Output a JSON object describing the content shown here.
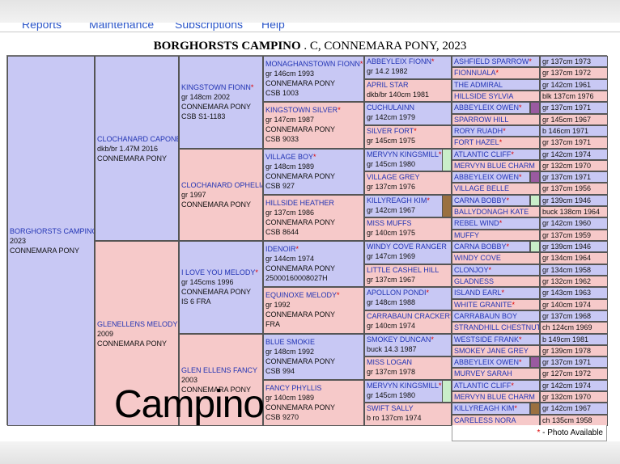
{
  "nav": [
    "Reports",
    "Maintenance",
    "Subscriptions",
    "Help"
  ],
  "title": {
    "bold": "BORGHORSTS CAMPINO",
    "rest": " . C, CONNEMARA PONY, 2023"
  },
  "watermark": "Campino",
  "footer": {
    "star": "*",
    "text": " - Photo Available"
  },
  "colors": {
    "male": "#c8c8f4",
    "female": "#f6c9c9",
    "link": "#2234b4",
    "star": "#dd0000",
    "swatch_green": "#c9eec9",
    "swatch_brown": "#9a7040",
    "swatch_purple": "#9a5aa0"
  },
  "horses": [
    {
      "id": "g1",
      "sex": "m",
      "name": "BORGHORSTS CAMPINO",
      "star": false,
      "lines": [
        "2023",
        "CONNEMARA PONY"
      ]
    },
    {
      "id": "g2s",
      "sex": "m",
      "name": "CLOCHANARD CAPONE",
      "star": false,
      "lines": [
        "dkb/br 1.47M 2016",
        "CONNEMARA PONY"
      ]
    },
    {
      "id": "g2d",
      "sex": "f",
      "name": "GLENELLENS MELODY",
      "star": false,
      "lines": [
        "2009",
        "CONNEMARA PONY"
      ]
    },
    {
      "id": "g3a",
      "sex": "m",
      "name": "KINGSTOWN FIONN",
      "star": true,
      "lines": [
        "gr 148cm 2002",
        "CONNEMARA PONY",
        "CSB S1-1183"
      ]
    },
    {
      "id": "g3b",
      "sex": "f",
      "name": "CLOCHANARD OPHELIA",
      "star": false,
      "lines": [
        "gr 1997",
        "CONNEMARA PONY"
      ]
    },
    {
      "id": "g3c",
      "sex": "m",
      "name": "I LOVE YOU MELODY",
      "star": true,
      "lines": [
        "gr 145cms 1996",
        "CONNEMARA PONY",
        "IS 6 FRA"
      ]
    },
    {
      "id": "g3d",
      "sex": "f",
      "name": "GLEN ELLENS FANCY",
      "star": false,
      "lines": [
        "2003",
        "CONNEMARA PONY"
      ]
    },
    {
      "id": "g4a",
      "sex": "m",
      "name": "MONAGHANSTOWN FIONN",
      "star": true,
      "lines": [
        "gr 146cm 1993",
        "CONNEMARA PONY",
        "CSB 1003"
      ]
    },
    {
      "id": "g4b",
      "sex": "f",
      "name": "KINGSTOWN SILVER",
      "star": true,
      "lines": [
        "gr 147cm 1987",
        "CONNEMARA PONY",
        "CSB 9033"
      ]
    },
    {
      "id": "g4c",
      "sex": "m",
      "name": "VILLAGE BOY",
      "star": true,
      "lines": [
        "gr 148cm 1989",
        "CONNEMARA PONY",
        "CSB 927"
      ]
    },
    {
      "id": "g4d",
      "sex": "f",
      "name": "HILLSIDE HEATHER",
      "star": false,
      "lines": [
        "gr 137cm 1986",
        "CONNEMARA PONY",
        "CSB 8644"
      ]
    },
    {
      "id": "g4e",
      "sex": "m",
      "name": "IDENOIR",
      "star": true,
      "lines": [
        "gr 144cm 1974",
        "CONNEMARA PONY",
        "25000160008027H"
      ]
    },
    {
      "id": "g4f",
      "sex": "f",
      "name": "EQUINOXE MELODY",
      "star": true,
      "lines": [
        "gr 1992",
        "CONNEMARA PONY",
        "FRA"
      ]
    },
    {
      "id": "g4g",
      "sex": "m",
      "name": "BLUE SMOKIE",
      "star": false,
      "lines": [
        "gr 148cm 1992",
        "CONNEMARA PONY",
        "CSB 994"
      ]
    },
    {
      "id": "g4h",
      "sex": "f",
      "name": "FANCY PHYLLIS",
      "star": false,
      "lines": [
        "gr 140cm 1989",
        "CONNEMARA PONY",
        "CSB 9270"
      ]
    },
    {
      "id": "g5a",
      "sex": "m",
      "name": "ABBEYLEIX FIONN",
      "star": true,
      "lines": [
        "gr 14.2 1982"
      ]
    },
    {
      "id": "g5b",
      "sex": "f",
      "name": "APRIL STAR",
      "star": false,
      "lines": [
        "dkb/br 140cm 1981"
      ]
    },
    {
      "id": "g5c",
      "sex": "m",
      "name": "CUCHULAINN",
      "star": false,
      "lines": [
        "gr 142cm 1979"
      ]
    },
    {
      "id": "g5d",
      "sex": "f",
      "name": "SILVER FORT",
      "star": true,
      "lines": [
        "gr 145cm 1975"
      ]
    },
    {
      "id": "g5e",
      "sex": "m",
      "name": "MERVYN KINGSMILL",
      "star": true,
      "lines": [
        "gr 145cm 1980"
      ]
    },
    {
      "id": "g5f",
      "sex": "f",
      "name": "VILLAGE GREY",
      "star": false,
      "lines": [
        "gr 137cm 1976"
      ]
    },
    {
      "id": "g5g",
      "sex": "m",
      "name": "KILLYREAGH KIM",
      "star": true,
      "lines": [
        "gr 142cm 1967"
      ]
    },
    {
      "id": "g5h",
      "sex": "f",
      "name": "MISS MUFFS",
      "star": false,
      "lines": [
        "gr 140cm 1975"
      ]
    },
    {
      "id": "g5i",
      "sex": "m",
      "name": "WINDY COVE RANGER",
      "star": false,
      "lines": [
        "gr 147cm 1969"
      ]
    },
    {
      "id": "g5j",
      "sex": "f",
      "name": "LITTLE CASHEL HILL",
      "star": false,
      "lines": [
        "gr 137cm 1967"
      ]
    },
    {
      "id": "g5k",
      "sex": "m",
      "name": "APOLLON PONDI",
      "star": true,
      "lines": [
        "gr 148cm 1988"
      ]
    },
    {
      "id": "g5l",
      "sex": "f",
      "name": "CARRABAUN CRACKER",
      "star": true,
      "lines": [
        "gr 140cm 1974"
      ]
    },
    {
      "id": "g5m",
      "sex": "m",
      "name": "SMOKEY DUNCAN",
      "star": true,
      "lines": [
        "buck 14.3 1987"
      ]
    },
    {
      "id": "g5n",
      "sex": "f",
      "name": "MISS LOGAN",
      "star": false,
      "lines": [
        "gr 137cm 1978"
      ]
    },
    {
      "id": "g5o",
      "sex": "m",
      "name": "MERVYN KINGSMILL",
      "star": true,
      "lines": [
        "gr 145cm 1980"
      ]
    },
    {
      "id": "g5p",
      "sex": "f",
      "name": "SWIFT SALLY",
      "star": false,
      "lines": [
        "b ro 137cm 1974"
      ]
    }
  ],
  "g6": [
    {
      "sex": "m",
      "name": "ASHFIELD SPARROW",
      "star": true,
      "info": "gr 137cm 1973"
    },
    {
      "sex": "f",
      "name": "FIONNUALA",
      "star": true,
      "info": "gr 137cm 1972"
    },
    {
      "sex": "m",
      "name": "THE ADMIRAL",
      "star": false,
      "info": "gr 142cm 1961"
    },
    {
      "sex": "f",
      "name": "HILLSIDE SYLVIA",
      "star": false,
      "info": "blk 137cm 1976"
    },
    {
      "sex": "m",
      "name": "ABBEYLEIX OWEN",
      "star": true,
      "info": "gr 137cm 1971",
      "swatch": "purple"
    },
    {
      "sex": "f",
      "name": "SPARROW HILL",
      "star": false,
      "info": "gr 145cm 1967"
    },
    {
      "sex": "m",
      "name": "RORY RUADH",
      "star": true,
      "info": "b 146cm 1971"
    },
    {
      "sex": "f",
      "name": "FORT HAZEL",
      "star": true,
      "info": "gr 137cm 1971"
    },
    {
      "sex": "m",
      "name": "ATLANTIC CLIFF",
      "star": true,
      "info": "gr 142cm 1974"
    },
    {
      "sex": "f",
      "name": "MERVYN BLUE CHARM",
      "star": false,
      "info": "gr 132cm 1970"
    },
    {
      "sex": "m",
      "name": "ABBEYLEIX OWEN",
      "star": true,
      "info": "gr 137cm 1971",
      "swatch": "purple"
    },
    {
      "sex": "f",
      "name": "VILLAGE BELLE",
      "star": false,
      "info": "gr 137cm 1956"
    },
    {
      "sex": "m",
      "name": "CARNA BOBBY",
      "star": true,
      "info": "gr 139cm 1946",
      "swatch": "green"
    },
    {
      "sex": "f",
      "name": "BALLYDONAGH KATE",
      "star": false,
      "info": "buck 138cm 1964"
    },
    {
      "sex": "m",
      "name": "REBEL WIND",
      "star": true,
      "info": "gr 142cm 1960"
    },
    {
      "sex": "f",
      "name": "MUFFY",
      "star": false,
      "info": "gr 137cm 1959"
    },
    {
      "sex": "m",
      "name": "CARNA BOBBY",
      "star": true,
      "info": "gr 139cm 1946",
      "swatch": "green"
    },
    {
      "sex": "f",
      "name": "WINDY COVE",
      "star": false,
      "info": "gr 134cm 1964"
    },
    {
      "sex": "m",
      "name": "CLONJOY",
      "star": true,
      "info": "gr 134cm 1958"
    },
    {
      "sex": "f",
      "name": "GLADNESS",
      "star": false,
      "info": "gr 132cm 1962"
    },
    {
      "sex": "m",
      "name": "ISLAND EARL",
      "star": true,
      "info": "gr 143cm 1963"
    },
    {
      "sex": "f",
      "name": "WHITE GRANITE",
      "star": true,
      "info": "gr 140cm 1974"
    },
    {
      "sex": "m",
      "name": "CARRABAUN BOY",
      "star": false,
      "info": "gr 137cm 1968"
    },
    {
      "sex": "f",
      "name": "STRANDHILL CHESTNUT",
      "star": false,
      "info": "ch 124cm 1969"
    },
    {
      "sex": "m",
      "name": "WESTSIDE FRANK",
      "star": true,
      "info": "b 149cm 1981"
    },
    {
      "sex": "f",
      "name": "SMOKEY JANE GREY",
      "star": false,
      "info": "gr 139cm 1978"
    },
    {
      "sex": "m",
      "name": "ABBEYLEIX OWEN",
      "star": true,
      "info": "gr 137cm 1971",
      "swatch": "purple"
    },
    {
      "sex": "f",
      "name": "MURVEY SARAH",
      "star": false,
      "info": "gr 127cm 1972"
    },
    {
      "sex": "m",
      "name": "ATLANTIC CLIFF",
      "star": true,
      "info": "gr 142cm 1974"
    },
    {
      "sex": "f",
      "name": "MERVYN BLUE CHARM",
      "star": false,
      "info": "gr 132cm 1970"
    },
    {
      "sex": "m",
      "name": "KILLYREAGH KIM",
      "star": true,
      "info": "gr 142cm 1967",
      "swatch": "brown"
    },
    {
      "sex": "f",
      "name": "CARELESS NORA",
      "star": false,
      "info": "ch 135cm 1958"
    }
  ],
  "g5_swatches": {
    "g5e": "green",
    "g5g": "brown",
    "g5o": "green"
  }
}
